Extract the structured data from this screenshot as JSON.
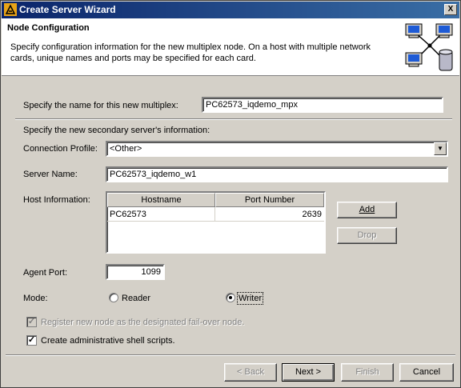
{
  "window": {
    "title": "Create Server Wizard",
    "close_label": "X"
  },
  "header": {
    "title": "Node Configuration",
    "description": "Specify configuration information for the new multiplex node.  On a host with multiple network cards, unique names and ports may be specified for each card."
  },
  "multiplex": {
    "label": "Specify the name for this new multiplex:",
    "value": "PC62573_iqdemo_mpx"
  },
  "secondary": {
    "section_label": "Specify the new secondary server's information:",
    "connection_profile_label": "Connection Profile:",
    "connection_profile_value": "<Other>",
    "server_name_label": "Server Name:",
    "server_name_value": "PC62573_iqdemo_w1",
    "host_info_label": "Host Information:",
    "host_table": {
      "columns": [
        "Hostname",
        "Port Number"
      ],
      "rows": [
        {
          "hostname": "PC62573",
          "port": "2639"
        }
      ]
    },
    "add_label": "Add",
    "drop_label": "Drop",
    "agent_port_label": "Agent Port:",
    "agent_port_value": "1099",
    "mode_label": "Mode:",
    "mode_options": [
      "Reader",
      "Writer"
    ],
    "mode_selected": "Writer",
    "failover_label": "Register new node as the designated fail-over node.",
    "failover_checked": true,
    "failover_enabled": false,
    "shell_scripts_label": "Create administrative shell scripts.",
    "shell_scripts_checked": true
  },
  "footer": {
    "back_label": "< Back",
    "next_label": "Next >",
    "finish_label": "Finish",
    "cancel_label": "Cancel"
  }
}
